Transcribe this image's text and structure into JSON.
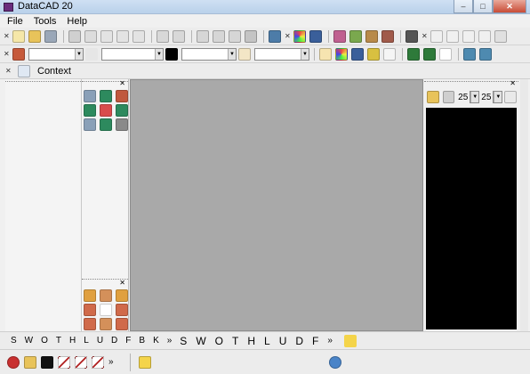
{
  "window": {
    "title": "DataCAD 20",
    "app_icon": "datacad-icon",
    "buttons": {
      "minimize": "–",
      "maximize": "□",
      "close": "✕"
    }
  },
  "menubar": {
    "items": [
      "File",
      "Tools",
      "Help"
    ]
  },
  "context": {
    "label": "Context",
    "icon": "context-icon"
  },
  "rightpanel": {
    "value_a": "25",
    "value_b": "25"
  },
  "keyrow": {
    "small_keys": [
      "S",
      "W",
      "O",
      "T",
      "H",
      "L",
      "U",
      "D",
      "F",
      "B",
      "K"
    ],
    "large_keys": [
      "S",
      "W",
      "O",
      "T",
      "H",
      "L",
      "U",
      "D",
      "F"
    ],
    "more_glyph": "»"
  },
  "colors": {
    "canvas": "#a9a9a9",
    "black_view": "#000000",
    "layer_swatch": "#c65a3b"
  },
  "icons": [
    "new-icon",
    "open-icon",
    "save-icon",
    "print-icon",
    "undo-icon",
    "redo-icon",
    "zoom-in-icon",
    "zoom-out-icon",
    "pan-icon",
    "lightbulb-icon",
    "info-icon",
    "warning-icon"
  ]
}
